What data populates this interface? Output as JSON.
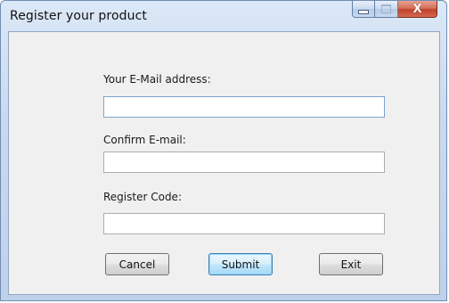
{
  "window": {
    "title": "Register your product"
  },
  "form": {
    "email_label": "Your E-Mail address:",
    "email_value": "",
    "confirm_label": "Confirm E-mail:",
    "confirm_value": "",
    "code_label": "Register Code:",
    "code_value": ""
  },
  "buttons": {
    "cancel": "Cancel",
    "submit": "Submit",
    "exit": "Exit"
  },
  "icons": {
    "minimize": "minimize-icon",
    "maximize": "maximize-icon",
    "close": "close-icon",
    "close_glyph": "X"
  },
  "colors": {
    "close_button": "#c0412a",
    "default_button_border": "#3c7fb1"
  }
}
